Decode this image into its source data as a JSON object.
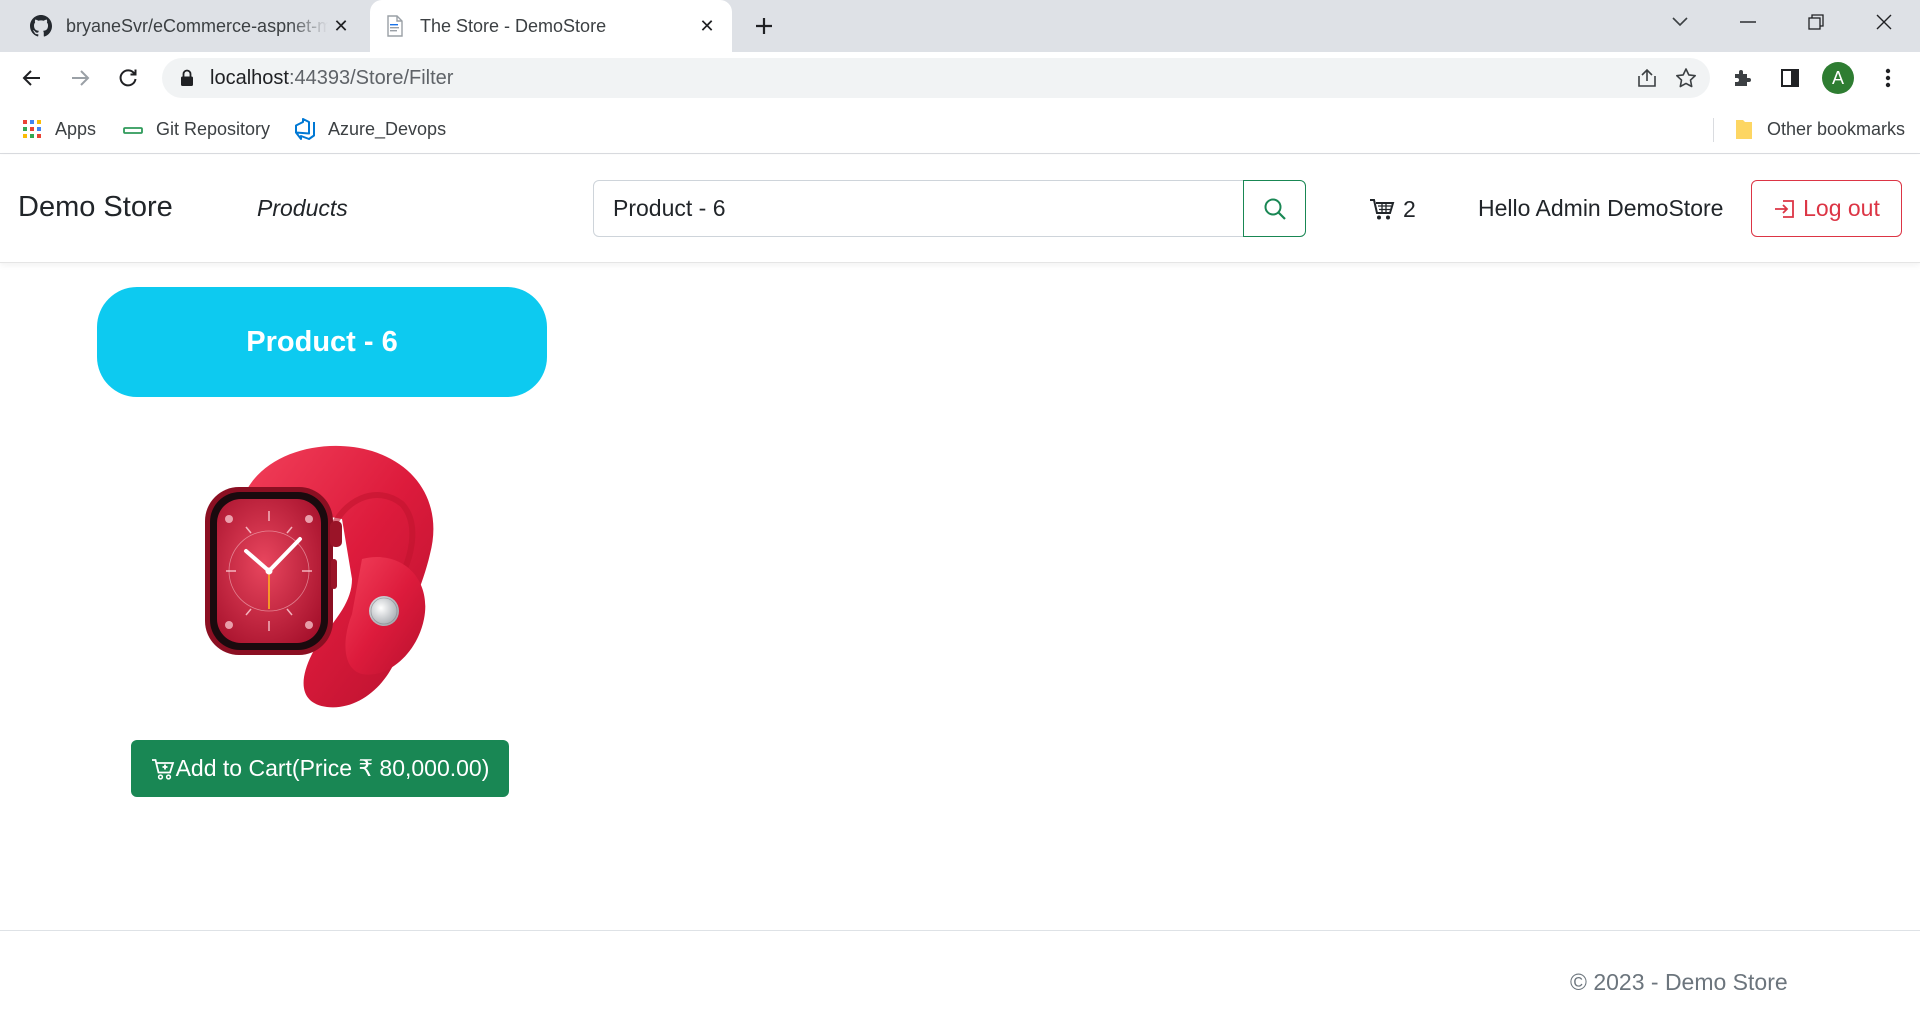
{
  "browser": {
    "tabs": [
      {
        "title": "bryaneSvr/eCommerce-aspnet-mvc",
        "favicon": "github-icon",
        "active": false
      },
      {
        "title": "The Store - DemoStore",
        "favicon": "document-icon",
        "active": true
      }
    ],
    "address": {
      "host": "localhost",
      "path": ":44393/Store/Filter"
    },
    "profile_initial": "A",
    "bookmarks": [
      {
        "label": "Apps",
        "icon": "apps-grid-icon"
      },
      {
        "label": "Git Repository",
        "icon": "git-icon"
      },
      {
        "label": "Azure_Devops",
        "icon": "azure-devops-icon"
      }
    ],
    "other_bookmarks": "Other bookmarks"
  },
  "navbar": {
    "brand": "Demo Store",
    "products_link": "Products",
    "search_value": "Product - 6",
    "cart_count": "2",
    "greeting": "Hello Admin DemoStore",
    "logout_label": "Log out"
  },
  "product": {
    "title": "Product - 6",
    "image": "red-smartwatch-image",
    "add_to_cart_label": "Add to Cart(Price ₹ 80,000.00)"
  },
  "footer": {
    "text": "© 2023 - Demo Store"
  },
  "colors": {
    "primary_info": "#0dcaf0",
    "success": "#198754",
    "danger": "#dc3545",
    "chrome_bg": "#dee1e6"
  }
}
